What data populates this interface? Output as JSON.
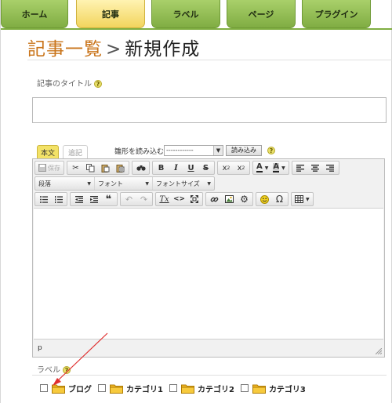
{
  "nav": {
    "tabs": [
      {
        "label": "ホーム",
        "active": false
      },
      {
        "label": "記事",
        "active": true
      },
      {
        "label": "ラベル",
        "active": false
      },
      {
        "label": "ページ",
        "active": false
      },
      {
        "label": "プラグイン",
        "active": false
      }
    ]
  },
  "heading": {
    "breadcrumb": "記事一覧",
    "separator": ">",
    "current": "新規作成"
  },
  "form": {
    "title_label": "記事のタイトル",
    "title_value": "",
    "help_glyph": "?"
  },
  "editor": {
    "tab_body": "本文",
    "tab_extra": "追記",
    "template_label": "雛形を読み込む",
    "template_selected": "------------",
    "load_button": "読み込み",
    "toolbar_row1": {
      "save": "保存",
      "bold": "B",
      "italic": "I",
      "underline": "U",
      "strike": "S",
      "subscript": "x",
      "subscript_mark": "2",
      "superscript": "x",
      "superscript_mark": "2",
      "text_color": "A",
      "bg_color": "A"
    },
    "toolbar_row2": {
      "format": "段落",
      "font": "フォント",
      "size": "フォントサイズ"
    },
    "toolbar_row3": {
      "blockquote": "❝",
      "omega": "Ω",
      "remove_format": "Tx",
      "source": "<>"
    },
    "path": "p"
  },
  "labels": {
    "section_label": "ラベル",
    "categories": [
      "ブログ",
      "カテゴリ1",
      "カテゴリ2",
      "カテゴリ3"
    ]
  },
  "colors": {
    "nav_green": "#8bb94b",
    "nav_active": "#f5dc6a",
    "heading_orange": "#c9741a",
    "annotation_arrow": "#e03030",
    "folder": "#f2b824"
  }
}
